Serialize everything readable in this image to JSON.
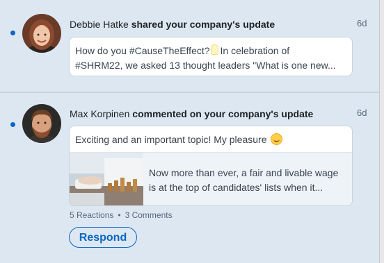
{
  "notifications": [
    {
      "actor": "Debbie Hatke",
      "action": "shared your company's update",
      "time": "6d",
      "snippet_line1": "How do you #CauseTheEffect?",
      "snippet_line1b": "In celebration of",
      "snippet_line2": "#SHRM22, we asked 13 thought leaders \"What is one new...",
      "unread": true
    },
    {
      "actor": "Max Korpinen",
      "action": "commented on your company's update",
      "time": "6d",
      "comment": "Exciting and an important topic! My pleasure",
      "preview_line1": "Now more than ever, a fair and livable wage",
      "preview_line2": "is at the top of candidates' lists when it...",
      "reactions": "5 Reactions",
      "separator": "•",
      "comments": "3 Comments",
      "respond_label": "Respond",
      "unread": true
    }
  ],
  "colors": {
    "accent": "#0a66c2",
    "unread_background": "#dde7f2"
  },
  "icons": {
    "light_bulb": "light-bulb-emoji-icon",
    "smile": "smiling-face-emoji-icon"
  }
}
